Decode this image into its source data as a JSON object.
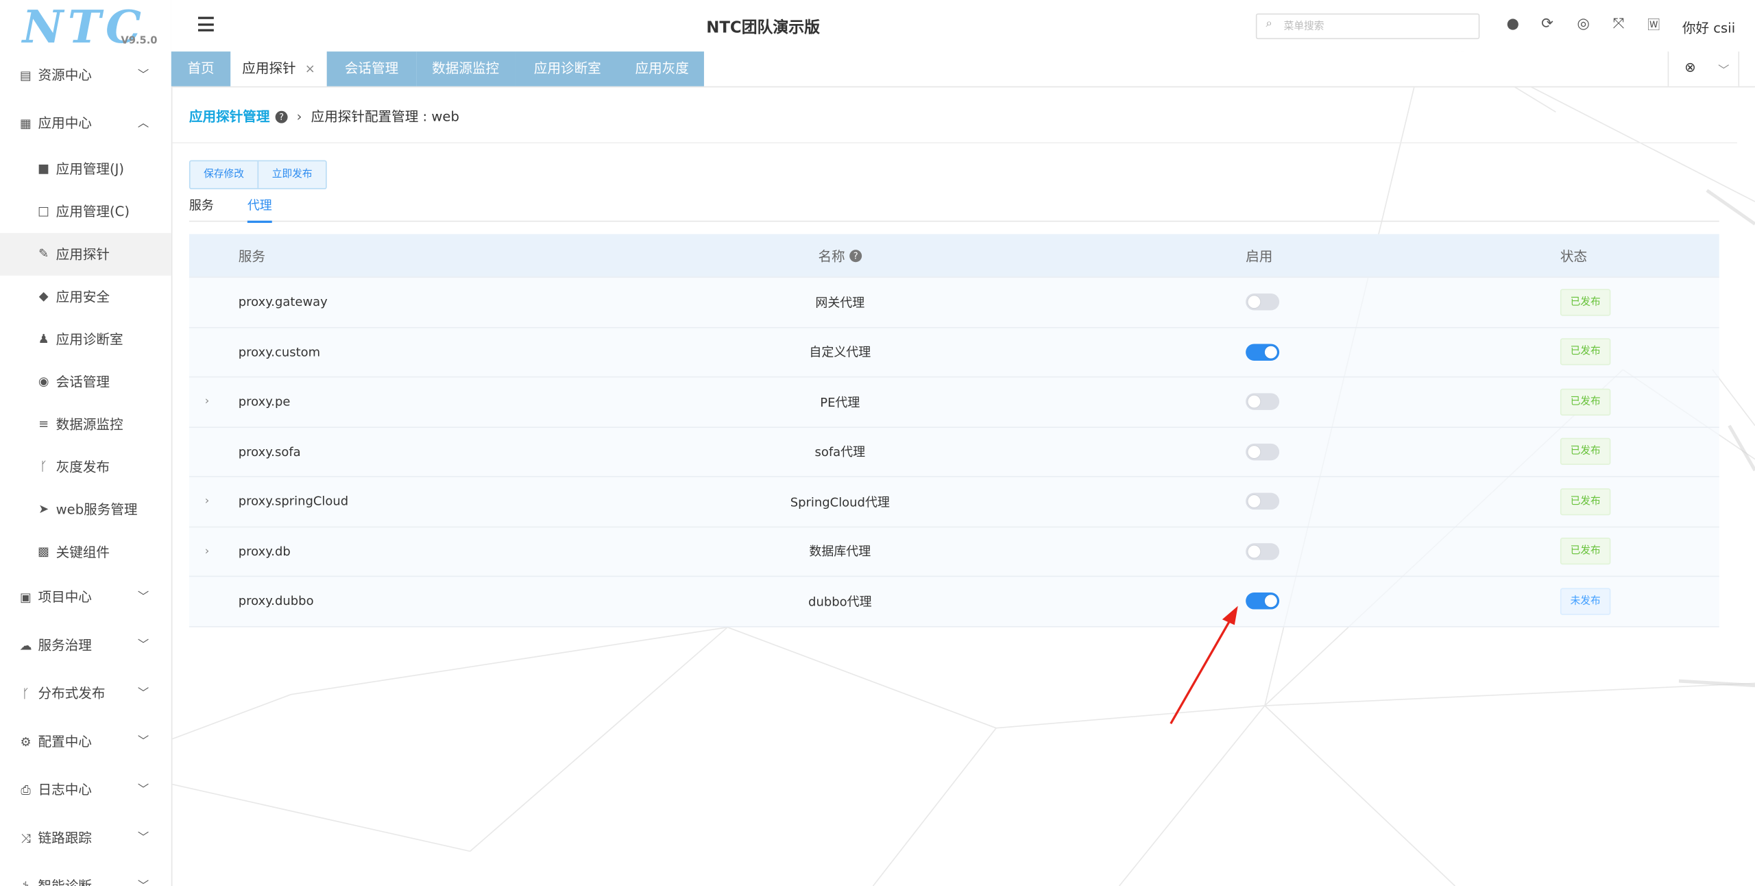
{
  "logo": {
    "text": "NTC",
    "version": "V9.5.0"
  },
  "header": {
    "app_title": "NTC团队演示版",
    "search_placeholder": "菜单搜索",
    "user": "你好 csii"
  },
  "sidebar": {
    "items": [
      {
        "label": "资源中心",
        "icon": "file-icon",
        "expanded": false
      },
      {
        "label": "应用中心",
        "icon": "apps-icon",
        "expanded": true
      }
    ],
    "sub_items": [
      {
        "label": "应用管理(J)",
        "icon": "folder-filled-icon"
      },
      {
        "label": "应用管理(C)",
        "icon": "folder-open-icon"
      },
      {
        "label": "应用探针",
        "icon": "paperclip-icon",
        "active": true
      },
      {
        "label": "应用安全",
        "icon": "shield-icon"
      },
      {
        "label": "应用诊断室",
        "icon": "user-md-icon"
      },
      {
        "label": "会话管理",
        "icon": "user-circle-icon"
      },
      {
        "label": "数据源监控",
        "icon": "database-icon"
      },
      {
        "label": "灰度发布",
        "icon": "branch-icon"
      },
      {
        "label": "web服务管理",
        "icon": "paper-plane-icon"
      },
      {
        "label": "关键组件",
        "icon": "grid-icon"
      }
    ],
    "bottom_items": [
      {
        "label": "项目中心",
        "icon": "project-icon"
      },
      {
        "label": "服务治理",
        "icon": "cloud-icon"
      },
      {
        "label": "分布式发布",
        "icon": "branch-icon"
      },
      {
        "label": "配置中心",
        "icon": "cogs-icon"
      },
      {
        "label": "日志中心",
        "icon": "print-icon"
      },
      {
        "label": "链路跟踪",
        "icon": "random-icon"
      },
      {
        "label": "智能诊断",
        "icon": "stethoscope-icon"
      }
    ]
  },
  "tabs": [
    {
      "label": "首页",
      "active": false
    },
    {
      "label": "应用探针",
      "active": true,
      "closable": true
    },
    {
      "label": "会话管理",
      "active": false
    },
    {
      "label": "数据源监控",
      "active": false
    },
    {
      "label": "应用诊断室",
      "active": false
    },
    {
      "label": "应用灰度",
      "active": false
    }
  ],
  "breadcrumb": {
    "root": "应用探针管理",
    "current": "应用探针配置管理 : web"
  },
  "actions": {
    "save": "保存修改",
    "publish": "立即发布"
  },
  "subtabs": [
    {
      "label": "服务",
      "active": false
    },
    {
      "label": "代理",
      "active": true
    }
  ],
  "table": {
    "headers": {
      "service": "服务",
      "name": "名称",
      "enabled": "启用",
      "status": "状态"
    },
    "rows": [
      {
        "service": "proxy.gateway",
        "name": "网关代理",
        "enabled": false,
        "status": "已发布",
        "expandable": false
      },
      {
        "service": "proxy.custom",
        "name": "自定义代理",
        "enabled": true,
        "status": "已发布",
        "expandable": false
      },
      {
        "service": "proxy.pe",
        "name": "PE代理",
        "enabled": false,
        "status": "已发布",
        "expandable": true
      },
      {
        "service": "proxy.sofa",
        "name": "sofa代理",
        "enabled": false,
        "status": "已发布",
        "expandable": false
      },
      {
        "service": "proxy.springCloud",
        "name": "SpringCloud代理",
        "enabled": false,
        "status": "已发布",
        "expandable": true
      },
      {
        "service": "proxy.db",
        "name": "数据库代理",
        "enabled": false,
        "status": "已发布",
        "expandable": true
      },
      {
        "service": "proxy.dubbo",
        "name": "dubbo代理",
        "enabled": true,
        "status": "未发布",
        "expandable": false
      }
    ]
  },
  "colors": {
    "accent": "#2d8cf0",
    "breadcrumb": "#16a6e0",
    "tab_inactive": "#8cbddc",
    "published": "#67c23a",
    "annotation_arrow": "#e8231a"
  }
}
